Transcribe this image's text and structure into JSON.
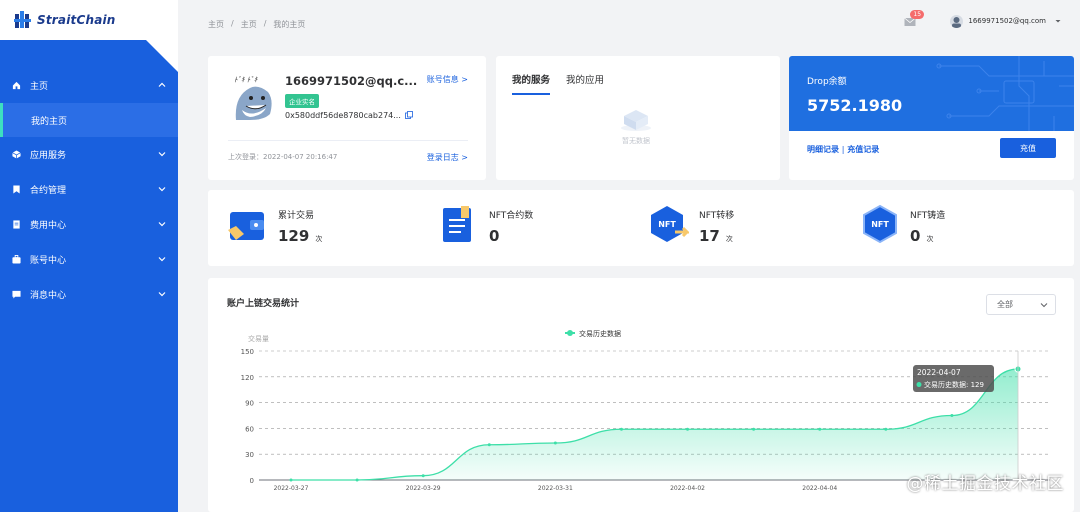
{
  "brand": {
    "name": "StraitChain"
  },
  "sidebar": {
    "items": [
      {
        "label": "主页"
      },
      {
        "label": "应用服务"
      },
      {
        "label": "合约管理"
      },
      {
        "label": "费用中心"
      },
      {
        "label": "账号中心"
      },
      {
        "label": "消息中心"
      }
    ],
    "sub_items": [
      {
        "label": "我的主页"
      }
    ]
  },
  "breadcrumb": {
    "items": [
      "主页",
      "/",
      "主页",
      "/",
      "我的主页"
    ]
  },
  "header": {
    "message_count": "15",
    "user_email": "1669971502@qq.com"
  },
  "account": {
    "email": "1669971502@qq.c...",
    "info_link": "账号信息 >",
    "tag": "企业实名",
    "address": "0x580ddf56de8780cab274...",
    "last_login": "上次登录：2022-04-07 20:16:47",
    "log_link": "登录日志 >"
  },
  "services": {
    "tabs": [
      {
        "label": "我的服务"
      },
      {
        "label": "我的应用"
      }
    ],
    "empty_text": "暂无数据"
  },
  "drop": {
    "title": "Drop余额",
    "amount": "5752.1980",
    "link_detail": "明细记录",
    "separator": "|",
    "link_recharge": "充值记录",
    "button": "充值"
  },
  "stats": [
    {
      "label": "累计交易",
      "value": "129",
      "unit": "次"
    },
    {
      "label": "NFT合约数",
      "value": "0",
      "unit": ""
    },
    {
      "label": "NFT转移",
      "value": "17",
      "unit": "次"
    },
    {
      "label": "NFT铸造",
      "value": "0",
      "unit": "次"
    }
  ],
  "nft_icon_text": "NFT",
  "chart_section": {
    "title": "账户上链交易统计",
    "select_value": "全部"
  },
  "chart_data": {
    "type": "area",
    "title": "",
    "legend": "交易历史数据",
    "legend_position": "top-center",
    "ylabel": "交易量",
    "ylim": [
      0,
      150
    ],
    "yticks": [
      0,
      30,
      60,
      90,
      120,
      150
    ],
    "x": [
      "2022-03-27",
      "2022-03-28",
      "2022-03-29",
      "2022-03-30",
      "2022-03-31",
      "2022-04-01",
      "2022-04-02",
      "2022-04-03",
      "2022-04-04",
      "2022-04-05",
      "2022-04-06",
      "2022-04-07"
    ],
    "xtick_labels": [
      "2022-03-27",
      "2022-03-29",
      "2022-03-31",
      "2022-04-02",
      "2022-04-04"
    ],
    "series": [
      {
        "name": "交易历史数据",
        "values": [
          0,
          0,
          5,
          41,
          43,
          59,
          59,
          59,
          59,
          59,
          75,
          129
        ]
      }
    ],
    "tooltip": {
      "date": "2022-04-07",
      "label": "交易历史数据",
      "value": "129"
    },
    "grid": true,
    "color": "#3ddfa8"
  },
  "watermark": "@稀土掘金技术社区"
}
